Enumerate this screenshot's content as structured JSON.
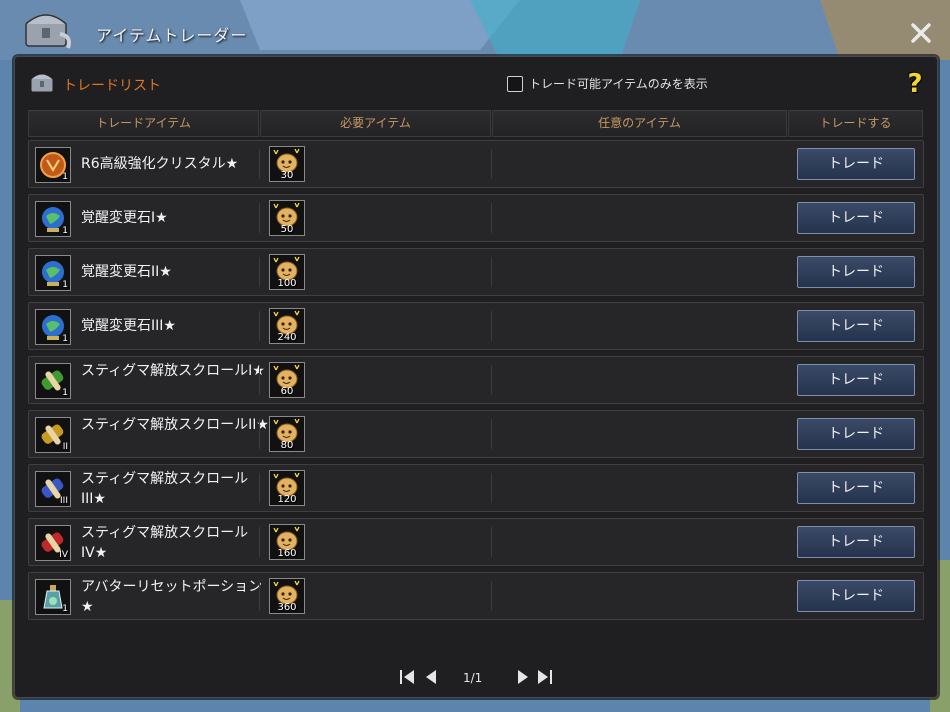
{
  "window": {
    "title": "アイテムトレーダー"
  },
  "panel": {
    "title": "トレードリスト",
    "filter_label": "トレード可能アイテムのみを表示",
    "help": "?"
  },
  "columns": [
    "トレードアイテム",
    "必要アイテム",
    "任意のアイテム",
    "トレードする"
  ],
  "rows": [
    {
      "name": "R6高級強化クリスタル★",
      "qty": "1",
      "required_qty": "30",
      "button": "トレード",
      "icon": "crystal-icon",
      "color": "#c15a19"
    },
    {
      "name": "覚醒変更石I★",
      "qty": "1",
      "required_qty": "50",
      "button": "トレード",
      "icon": "globe-icon",
      "color": "#2d6fd0"
    },
    {
      "name": "覚醒変更石II★",
      "qty": "1",
      "required_qty": "100",
      "button": "トレード",
      "icon": "globe-icon",
      "color": "#2d6fd0"
    },
    {
      "name": "覚醒変更石III★",
      "qty": "1",
      "required_qty": "240",
      "button": "トレード",
      "icon": "globe-icon",
      "color": "#2d6fd0"
    },
    {
      "name": "スティグマ解放スクロールI★",
      "qty": "1",
      "required_qty": "60",
      "button": "トレード",
      "icon": "scroll-icon",
      "color": "#3f9a2f"
    },
    {
      "name": "スティグマ解放スクロールII★",
      "qty": "II",
      "required_qty": "80",
      "button": "トレード",
      "icon": "scroll-icon",
      "color": "#c79a20"
    },
    {
      "name": "スティグマ解放スクロールIII★",
      "qty": "III",
      "required_qty": "120",
      "button": "トレード",
      "icon": "scroll-icon",
      "color": "#3a56c8"
    },
    {
      "name": "スティグマ解放スクロールIV★",
      "qty": "IV",
      "required_qty": "160",
      "button": "トレード",
      "icon": "scroll-icon",
      "color": "#c1282a"
    },
    {
      "name": "アバターリセットポーション★",
      "qty": "1",
      "required_qty": "360",
      "button": "トレード",
      "icon": "potion-icon",
      "color": "#5aa0a8"
    }
  ],
  "pager": {
    "label": "1/1"
  }
}
